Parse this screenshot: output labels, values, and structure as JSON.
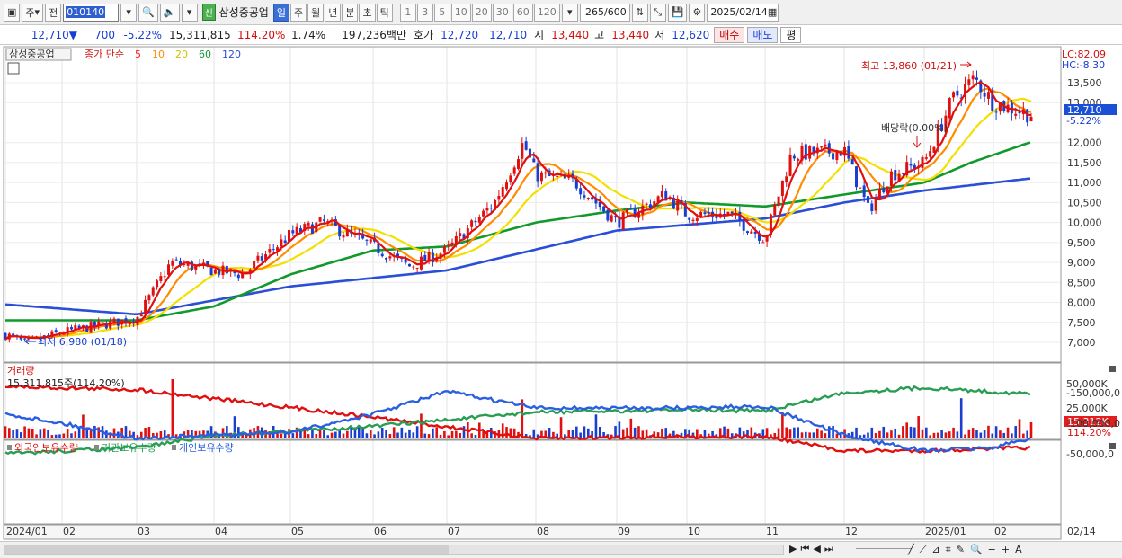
{
  "toolbar": {
    "market": "주",
    "prev": "전",
    "code": "010140",
    "badge": "신",
    "stock_name": "삼성중공업",
    "periods": [
      "일",
      "주",
      "월",
      "년",
      "분",
      "초",
      "틱"
    ],
    "selected_period": "일",
    "intervals": [
      "1",
      "3",
      "5",
      "10",
      "20",
      "30",
      "60",
      "120"
    ],
    "count": "265",
    "count_total": "/600",
    "date": "2025/02/14"
  },
  "quote": {
    "price": "12,710",
    "arrow": "▼",
    "change": "700",
    "change_pct": "-5.22%",
    "volume": "15,311,815",
    "volume_ratio": "114.20%",
    "turnover": "1.74%",
    "amount": "197,236백만",
    "bid_label": "호가",
    "bid1": "12,720",
    "bid2": "12,710",
    "open_label": "시",
    "open": "13,440",
    "high_label": "고",
    "high": "13,440",
    "low_label": "저",
    "low": "12,620",
    "buy_label": "매수",
    "sell_label": "매도",
    "eval_label": "평"
  },
  "price_panel": {
    "legend_name": "삼성중공업",
    "legend_type": "종가 단순",
    "ma_periods": [
      {
        "label": "5",
        "color": "#ff1a1a"
      },
      {
        "label": "10",
        "color": "#ff8c00"
      },
      {
        "label": "20",
        "color": "#f3e000"
      },
      {
        "label": "60",
        "color": "#12992c"
      },
      {
        "label": "120",
        "color": "#2a4fd6"
      }
    ],
    "lc": "LC:82.09",
    "hc": "HC:-8.30",
    "current_price": "12,710",
    "current_pct": "-5.22%",
    "high_note": "최고 13,860 (01/21)",
    "low_note": "최저 6,980 (01/18)",
    "dividend_note": "배당락(0.00%)",
    "y_ticks": [
      "13,500",
      "13,000",
      "12,000",
      "11,500",
      "11,000",
      "10,500",
      "10,000",
      "9,500",
      "9,000",
      "8,500",
      "8,000",
      "7,500",
      "7,000"
    ]
  },
  "volume_panel": {
    "title": "거래량",
    "value": "15,311,815주(114.20%)",
    "y_ticks": [
      "50,000K",
      "25,000K"
    ],
    "current": "15,312K",
    "current_pct": "114.20%"
  },
  "holdings_panel": {
    "series": [
      {
        "name": "외국인보유수량",
        "color": "#e01010"
      },
      {
        "name": "기관보유수량",
        "color": "#2a9d55"
      },
      {
        "name": "개인보유수량",
        "color": "#2a5fe0"
      }
    ],
    "y_ticks": [
      "-50,000,0",
      "-100,000,0",
      "-150,000,0"
    ]
  },
  "x_axis": {
    "labels": [
      "2024/01",
      "02",
      "03",
      "04",
      "05",
      "06",
      "07",
      "08",
      "09",
      "10",
      "11",
      "12",
      "2025/01",
      "02"
    ],
    "end_label": "02/14"
  },
  "chart_data": {
    "type": "candlestick",
    "series": [
      {
        "name": "삼성중공업",
        "anchors": [
          {
            "x": "2024/01",
            "y": 7200
          },
          {
            "x": "01/18",
            "y": 6980
          },
          {
            "x": "02",
            "y": 7250
          },
          {
            "x": "03",
            "y": 7600
          },
          {
            "x": "03/15",
            "y": 9000
          },
          {
            "x": "04",
            "y": 8800
          },
          {
            "x": "04/15",
            "y": 8700
          },
          {
            "x": "05",
            "y": 9700
          },
          {
            "x": "05/20",
            "y": 10000
          },
          {
            "x": "06",
            "y": 9400
          },
          {
            "x": "06/20",
            "y": 8900
          },
          {
            "x": "07",
            "y": 9300
          },
          {
            "x": "07/20",
            "y": 10500
          },
          {
            "x": "07/29",
            "y": 12000
          },
          {
            "x": "08",
            "y": 11200
          },
          {
            "x": "08/15",
            "y": 11000
          },
          {
            "x": "09",
            "y": 10000
          },
          {
            "x": "09/20",
            "y": 10700
          },
          {
            "x": "10",
            "y": 10200
          },
          {
            "x": "10/20",
            "y": 10200
          },
          {
            "x": "11",
            "y": 9600
          },
          {
            "x": "11/15",
            "y": 11700
          },
          {
            "x": "12",
            "y": 11800
          },
          {
            "x": "12/10",
            "y": 10300
          },
          {
            "x": "12/20",
            "y": 11200
          },
          {
            "x": "2025/01",
            "y": 11500
          },
          {
            "x": "01/15",
            "y": 13100
          },
          {
            "x": "01/21",
            "y": 13600
          },
          {
            "x": "02",
            "y": 13000
          },
          {
            "x": "02/14",
            "y": 12710
          }
        ]
      }
    ],
    "ma": [
      {
        "name": "120",
        "anchors": [
          {
            "x": "2024/01",
            "y": 7950
          },
          {
            "x": "03",
            "y": 7700
          },
          {
            "x": "05",
            "y": 8400
          },
          {
            "x": "07",
            "y": 8800
          },
          {
            "x": "09",
            "y": 9800
          },
          {
            "x": "11",
            "y": 10100
          },
          {
            "x": "12",
            "y": 10500
          },
          {
            "x": "2025/01",
            "y": 10800
          },
          {
            "x": "02/14",
            "y": 11100
          }
        ]
      },
      {
        "name": "60",
        "anchors": [
          {
            "x": "2024/01",
            "y": 7550
          },
          {
            "x": "03",
            "y": 7550
          },
          {
            "x": "04",
            "y": 7900
          },
          {
            "x": "05",
            "y": 8700
          },
          {
            "x": "06",
            "y": 9300
          },
          {
            "x": "07",
            "y": 9400
          },
          {
            "x": "08",
            "y": 10000
          },
          {
            "x": "09",
            "y": 10300
          },
          {
            "x": "10",
            "y": 10500
          },
          {
            "x": "11",
            "y": 10400
          },
          {
            "x": "12",
            "y": 10700
          },
          {
            "x": "2025/01",
            "y": 11000
          },
          {
            "x": "01/20",
            "y": 11500
          },
          {
            "x": "02/14",
            "y": 12000
          }
        ]
      }
    ],
    "volume": [
      {
        "x": "03/15",
        "y": 56000
      },
      {
        "x": "07/29",
        "y": 37000
      },
      {
        "x": "2025/01/15",
        "y": 38000
      },
      {
        "x": "02/14",
        "y": 15312
      }
    ],
    "holdings": [
      {
        "name": "외국인보유수량",
        "anchors": [
          {
            "x": "2024/01",
            "y": -160000
          },
          {
            "x": "03",
            "y": -155000
          },
          {
            "x": "06",
            "y": -110000
          },
          {
            "x": "08",
            "y": -75000
          },
          {
            "x": "10",
            "y": -78000
          },
          {
            "x": "11",
            "y": -78000
          },
          {
            "x": "12",
            "y": -55000
          },
          {
            "x": "2025/01",
            "y": -55000
          },
          {
            "x": "02/14",
            "y": -60000
          }
        ]
      },
      {
        "name": "기관보유수량",
        "anchors": [
          {
            "x": "2024/01",
            "y": -50000
          },
          {
            "x": "03",
            "y": -60000
          },
          {
            "x": "04",
            "y": -80000
          },
          {
            "x": "06",
            "y": -95000
          },
          {
            "x": "08",
            "y": -118000
          },
          {
            "x": "10",
            "y": -122000
          },
          {
            "x": "11",
            "y": -120000
          },
          {
            "x": "12",
            "y": -150000
          },
          {
            "x": "2025/01",
            "y": -158000
          },
          {
            "x": "02/14",
            "y": -148000
          }
        ]
      },
      {
        "name": "개인보유수량",
        "anchors": [
          {
            "x": "2024/01",
            "y": -115000
          },
          {
            "x": "02",
            "y": -100000
          },
          {
            "x": "03",
            "y": -75000
          },
          {
            "x": "05",
            "y": -85000
          },
          {
            "x": "06",
            "y": -115000
          },
          {
            "x": "07",
            "y": -152000
          },
          {
            "x": "08",
            "y": -125000
          },
          {
            "x": "09",
            "y": -125000
          },
          {
            "x": "10",
            "y": -125000
          },
          {
            "x": "11",
            "y": -128000
          },
          {
            "x": "12",
            "y": -80000
          },
          {
            "x": "2025/01",
            "y": -55000
          },
          {
            "x": "02",
            "y": -60000
          },
          {
            "x": "02/14",
            "y": -75000
          }
        ]
      }
    ]
  }
}
